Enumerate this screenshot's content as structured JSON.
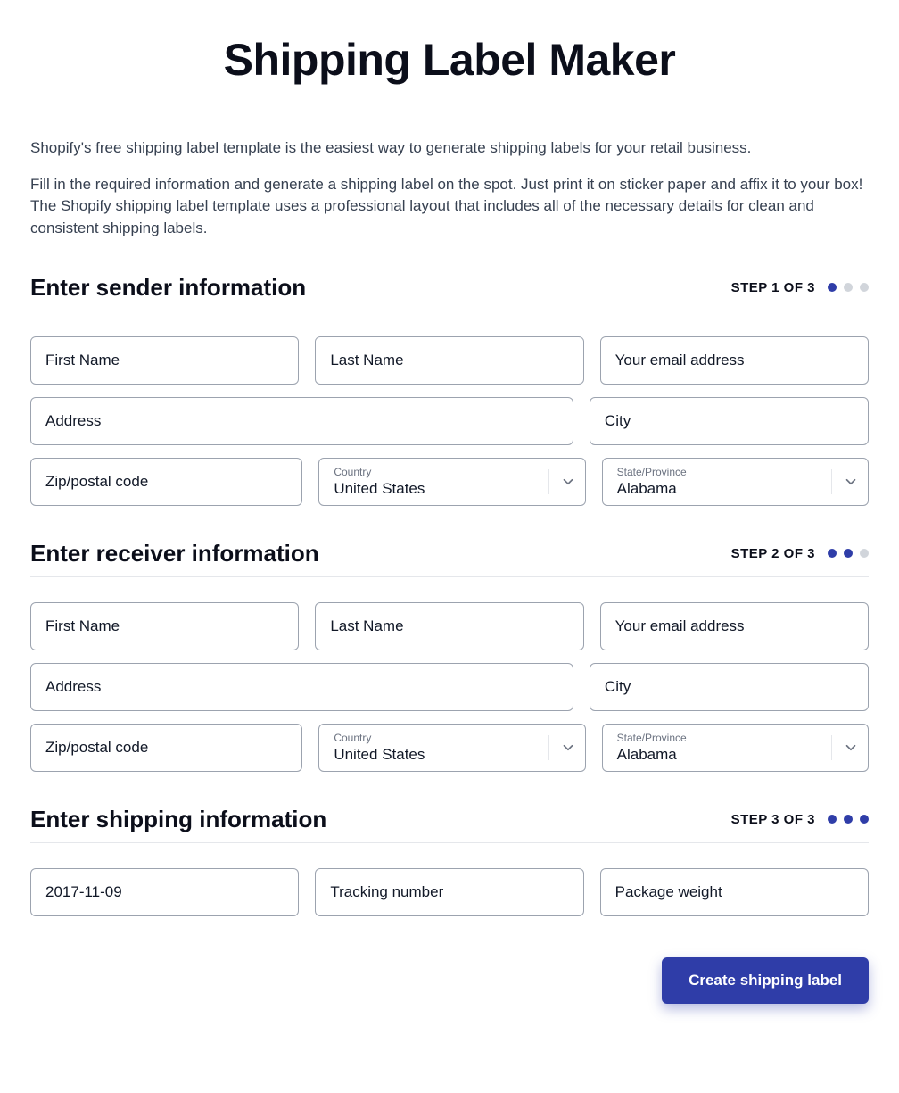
{
  "page_title": "Shipping Label Maker",
  "intro": {
    "p1": "Shopify's free shipping label template is the easiest way to generate shipping labels for your retail business.",
    "p2": "Fill in the required information and generate a shipping label on the spot. Just print it on sticker paper and affix it to your box! The Shopify shipping label template uses a professional layout that includes all of the necessary details for clean and consistent shipping labels."
  },
  "sender": {
    "heading": "Enter sender information",
    "step_label": "STEP 1 OF 3",
    "first_name_ph": "First Name",
    "last_name_ph": "Last Name",
    "email_ph": "Your email address",
    "address_ph": "Address",
    "city_ph": "City",
    "zip_ph": "Zip/postal code",
    "country_label": "Country",
    "country_value": "United States",
    "state_label": "State/Province",
    "state_value": "Alabama"
  },
  "receiver": {
    "heading": "Enter receiver information",
    "step_label": "STEP 2 OF 3",
    "first_name_ph": "First Name",
    "last_name_ph": "Last Name",
    "email_ph": "Your email address",
    "address_ph": "Address",
    "city_ph": "City",
    "zip_ph": "Zip/postal code",
    "country_label": "Country",
    "country_value": "United States",
    "state_label": "State/Province",
    "state_value": "Alabama"
  },
  "shipping": {
    "heading": "Enter shipping information",
    "step_label": "STEP 3 OF 3",
    "date_value": "2017-11-09",
    "tracking_ph": "Tracking number",
    "weight_ph": "Package weight"
  },
  "submit_label": "Create shipping label"
}
